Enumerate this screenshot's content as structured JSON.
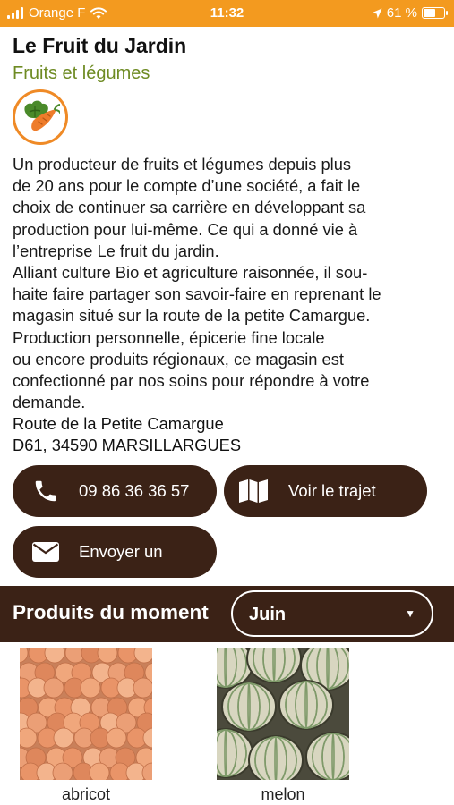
{
  "status_bar": {
    "carrier": "Orange F",
    "time": "11:32",
    "battery": "61 %",
    "battery_level": 0.61
  },
  "shop": {
    "name": "Le Fruit du Jardin",
    "category": "Fruits et légumes",
    "category_icon": "carrot-leaf-icon",
    "accent_orange": "#ef8a26",
    "accent_green": "#6e8b23",
    "description": "Un producteur de fruits et légumes depuis plus\nde 20 ans pour le compte d’une société, a fait le\nchoix de continuer sa carrière en développant sa\nproduction pour lui-même. Ce qui a donné vie à\nl’entreprise Le fruit du jardin.\nAlliant culture Bio et agriculture raisonnée, il sou-\nhaite faire partager son savoir-faire en reprenant le\nmagasin situé sur la route de la petite Camargue.\nProduction personnelle, épicerie fine locale\nou encore produits régionaux, ce magasin est\nconfectionné par nos soins pour répondre à votre\ndemande.",
    "address_line1": "Route de la Petite Camargue",
    "address_line2": "D61, 34590 MARSILLARGUES"
  },
  "actions": {
    "call_label": "09 86 36 36 57",
    "route_label": "Voir le trajet",
    "email_label": "Envoyer un",
    "button_color": "#3b2216"
  },
  "products": {
    "section_title": "Produits du moment",
    "selected_month": "Juin",
    "items": [
      {
        "name": "abricot"
      },
      {
        "name": "melon"
      }
    ]
  }
}
